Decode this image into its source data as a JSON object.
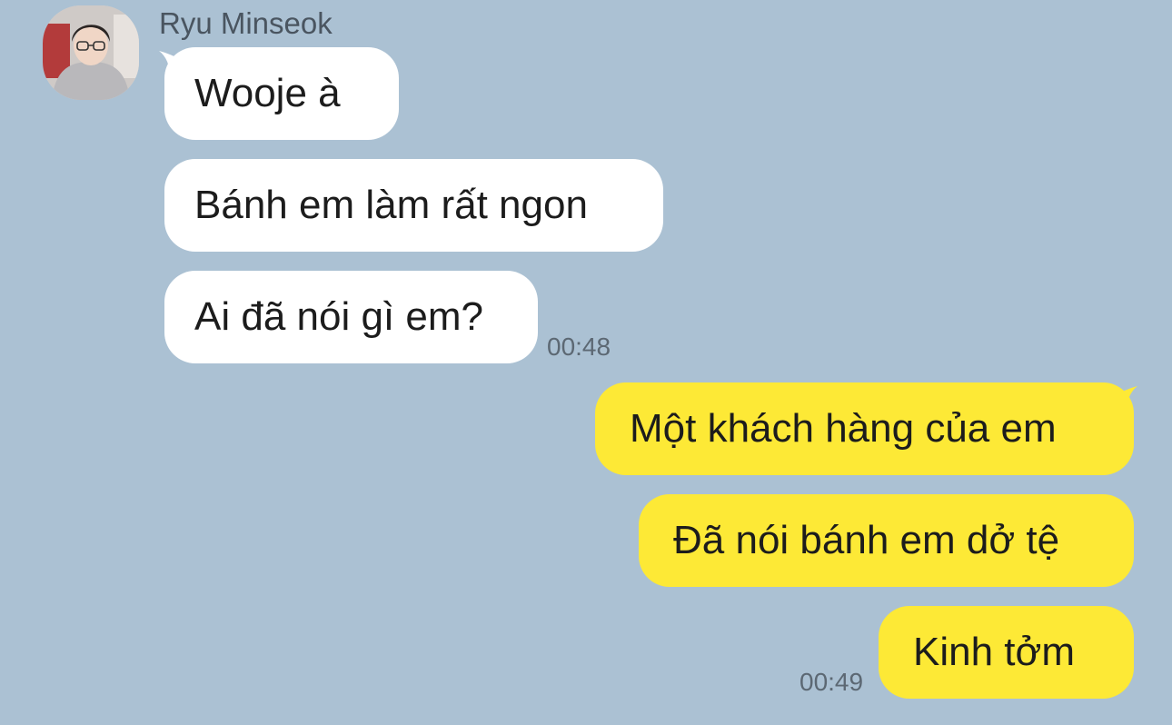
{
  "contact": {
    "name": "Ryu Minseok",
    "avatar_icon": "profile-photo"
  },
  "messages_in": [
    {
      "text": "Wooje à"
    },
    {
      "text": "Bánh em làm rất ngon"
    },
    {
      "text": "Ai đã nói gì em?"
    }
  ],
  "time_in": "00:48",
  "messages_out": [
    {
      "text": "Một khách hàng của em"
    },
    {
      "text": "Đã nói bánh em dở tệ"
    },
    {
      "text": "Kinh tởm"
    }
  ],
  "time_out": "00:49",
  "colors": {
    "background": "#abc1d3",
    "incoming_bubble": "#ffffff",
    "outgoing_bubble": "#fde936",
    "text": "#1c1c1c",
    "meta_text": "#5c6873"
  }
}
